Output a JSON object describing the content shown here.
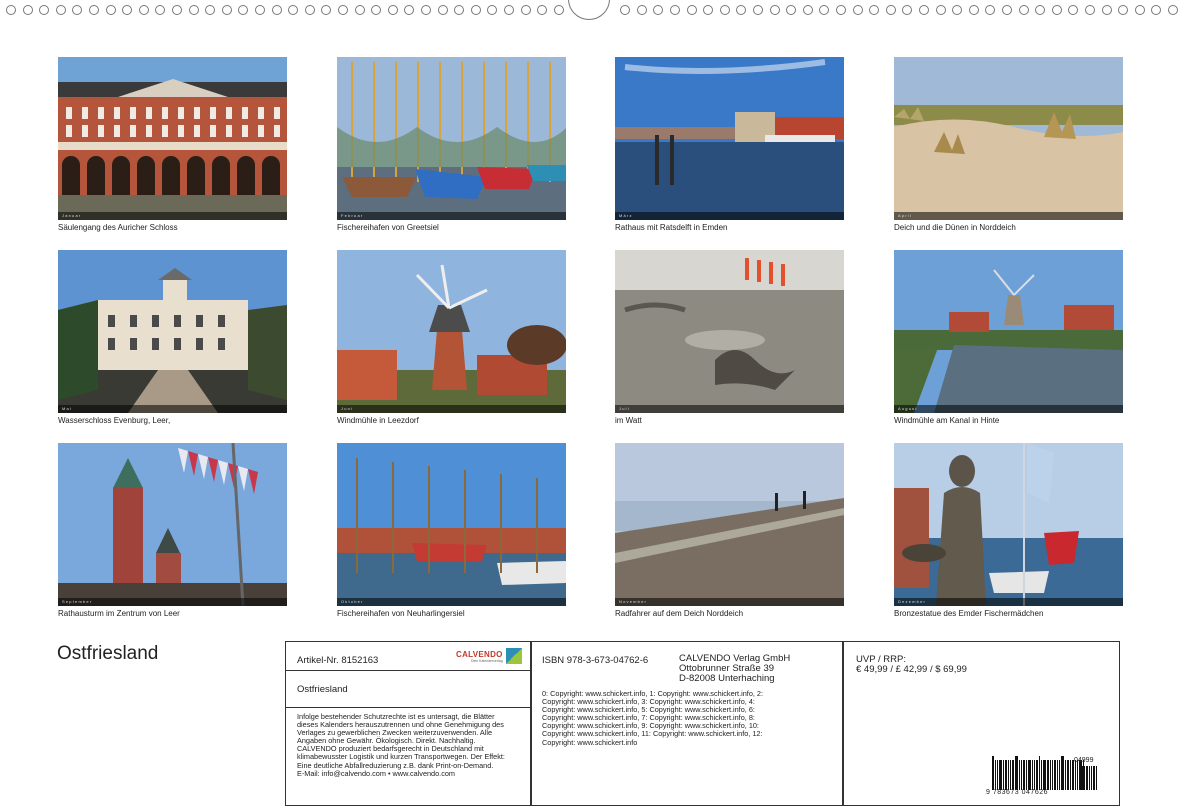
{
  "calendar_title": "Ostfriesland",
  "months": [
    {
      "strip": "Januar",
      "caption": "Säulengang des Auricher Schloss",
      "scene": "palace",
      "sky": "#6fa3d6"
    },
    {
      "strip": "Februar",
      "caption": "Fischereihafen von Greetsiel",
      "scene": "harbor",
      "sky": "#9bb8d8"
    },
    {
      "strip": "März",
      "caption": "Rathaus mit Ratsdelft in Emden",
      "scene": "townhall",
      "sky": "#3a78c8"
    },
    {
      "strip": "April",
      "caption": "Deich und die Dünen in Norddeich",
      "scene": "dunes",
      "sky": "#9fb9d6"
    },
    {
      "strip": "Mai",
      "caption": "Wasserschloss Evenburg, Leer,",
      "scene": "castle",
      "sky": "#5d93d0"
    },
    {
      "strip": "Juni",
      "caption": "Windmühle in Leezdorf",
      "scene": "mill",
      "sky": "#8fb4dd"
    },
    {
      "strip": "Juli",
      "caption": "im Watt",
      "scene": "watt",
      "sky": "#d8d6d0"
    },
    {
      "strip": "August",
      "caption": "Windmühle am Kanal in Hinte",
      "scene": "canal",
      "sky": "#6ea0d8"
    },
    {
      "strip": "September",
      "caption": "Rathausturm im Zentrum von Leer",
      "scene": "tower",
      "sky": "#7aa8dc"
    },
    {
      "strip": "Oktober",
      "caption": "Fischereihafen von Neuharlingersiel",
      "scene": "harbor2",
      "sky": "#4f8fd6"
    },
    {
      "strip": "November",
      "caption": "Radfahrer auf dem Deich Norddeich",
      "scene": "dike",
      "sky": "#b9c8dc"
    },
    {
      "strip": "Dezember",
      "caption": "Bronzestatue des Emder Fischermädchen",
      "scene": "statue",
      "sky": "#b8cde6"
    }
  ],
  "info": {
    "article": "Artikel-Nr. 8152163",
    "product_title": "Ostfriesland",
    "logo_text": "CALVENDO",
    "logo_sub": "Dein Kalenderverlag",
    "legal": "Infolge bestehender Schutzrechte ist es untersagt, die Blätter dieses Kalenders herauszutrennen und ohne Genehmigung des Verlages zu gewerblichen Zwecken weiterzuverwenden. Alle Angaben ohne Gewähr.",
    "eco": " Ökologisch. Direkt. Nachhaltig. CALVENDO produziert bedarfsgerecht in Deutschland mit klimabewusster Logistik und kurzen Transportwegen. Der Effekt: Eine deutliche Abfallreduzierung z.B. dank Print-on-Demand.",
    "contact": " E-Mail: info@calvendo.com • www.calvendo.com",
    "isbn": "ISBN 978-3-673-04762-6",
    "publisher": [
      "CALVENDO Verlag GmbH",
      "Ottobrunner Straße 39",
      "D-82008 Unterhaching"
    ],
    "copyright": "0: Copyright: www.schickert.info, 1: Copyright: www.schickert.info, 2: Copyright: www.schickert.info, 3: Copyright: www.schickert.info, 4: Copyright: www.schickert.info, 5: Copyright: www.schickert.info, 6: Copyright: www.schickert.info, 7: Copyright: www.schickert.info, 8: Copyright: www.schickert.info, 9: Copyright: www.schickert.info, 10: Copyright: www.schickert.info, 11: Copyright: www.schickert.info, 12: Copyright: www.schickert.info",
    "price_label": "UVP / RRP:",
    "price": "€ 49,99 / £ 42,99 / $ 69,99",
    "barcode_number": "9 783673 047626",
    "barcode_addon": "04999"
  }
}
